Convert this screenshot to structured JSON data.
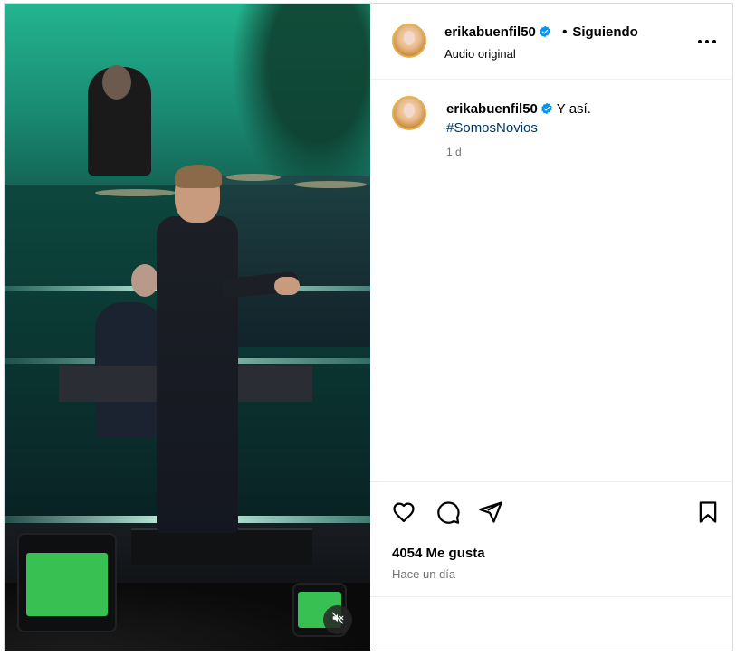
{
  "post": {
    "author": {
      "username": "erikabuenfil50",
      "verified": true,
      "follow_status": "Siguiendo",
      "separator": "•"
    },
    "audio_label": "Audio original",
    "caption": {
      "username": "erikabuenfil50",
      "text": "Y así.",
      "hashtag": "#SomosNovios",
      "time_ago": "1 d"
    },
    "likes_text": "4054 Me gusta",
    "posted_text": "Hace un día"
  },
  "icons": {
    "verified": "verified-badge-icon",
    "more": "more-options-icon",
    "like": "heart-icon",
    "comment": "comment-icon",
    "share": "send-icon",
    "save": "bookmark-icon",
    "mute": "speaker-muted-icon"
  },
  "colors": {
    "verified_blue": "#0095f6",
    "hashtag_link": "#00376b",
    "secondary_text": "#737373",
    "divider": "#efefef"
  }
}
